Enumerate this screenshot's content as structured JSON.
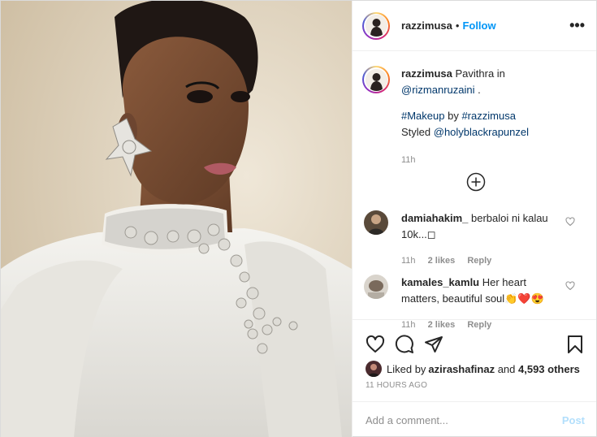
{
  "post": {
    "photo_alt": "",
    "username": "razzimusa",
    "separator": "•",
    "follow_label": "Follow",
    "more_label": "•••"
  },
  "caption": {
    "username": "razzimusa",
    "line1_text": " Pavithra in",
    "mention1": "@rizmanruzaini",
    "line1_end": " .",
    "hashtag1": "#Makeup",
    "by_text": " by ",
    "hashtag2": "#razzimusa",
    "styled_text": "Styled ",
    "mention2": "@holyblackrapunzel",
    "time": "11h"
  },
  "comments": [
    {
      "username": "damiahakim_",
      "text": " berbaloi ni kalau 10k...",
      "emoji": "◻",
      "time": "11h",
      "likes": "2 likes",
      "reply": "Reply"
    },
    {
      "username": "kamales_kamlu",
      "text": " Her heart matters, beautiful soul",
      "emoji": "👏❤️😍",
      "time": "11h",
      "likes": "2 likes",
      "reply": "Reply"
    }
  ],
  "likes": {
    "prefix": "Liked by ",
    "user": "azirashafinaz",
    "middle": " and ",
    "count": "4,593 others"
  },
  "timestamp": "11 HOURS AGO",
  "add_comment": {
    "placeholder": "Add a comment...",
    "post_label": "Post"
  },
  "colors": {
    "accent": "#0095f6",
    "link": "#00376b",
    "muted": "#8e8e8e",
    "post_disabled": "#b2dffc"
  },
  "icons": [
    "heart-icon",
    "comment-icon",
    "share-icon",
    "bookmark-icon",
    "plus-circle-icon",
    "more-icon"
  ]
}
